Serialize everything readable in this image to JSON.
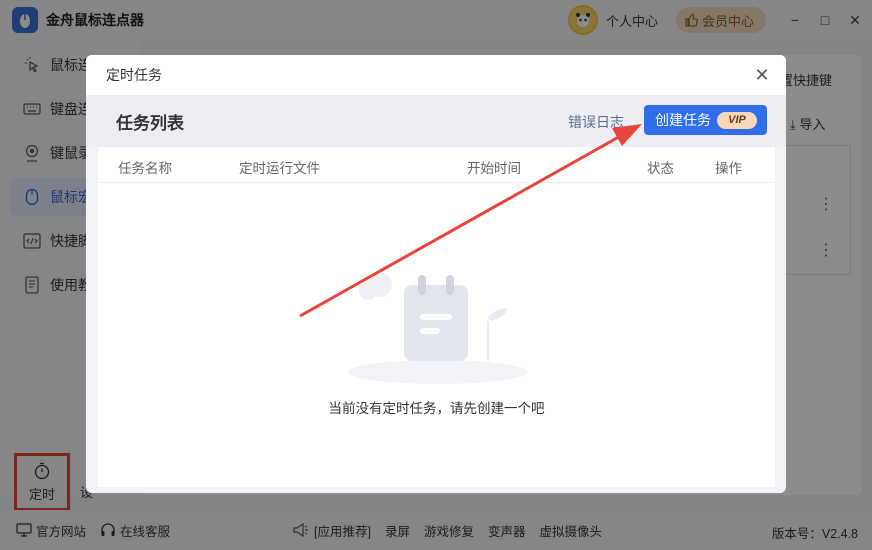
{
  "app": {
    "title": "金舟鼠标连点器",
    "user_center": "个人中心",
    "vip_center": "会员中心",
    "minimize": "−",
    "maximize": "□",
    "close": "✕"
  },
  "sidebar": {
    "items": [
      {
        "label": "鼠标连",
        "icon": "cursor-click-icon"
      },
      {
        "label": "键盘连",
        "icon": "keyboard-icon"
      },
      {
        "label": "键鼠录",
        "icon": "record-icon"
      },
      {
        "label": "鼠标宏",
        "icon": "mouse-icon"
      },
      {
        "label": "快捷脚",
        "icon": "code-icon"
      },
      {
        "label": "使用教",
        "icon": "book-icon"
      }
    ],
    "timer_label": "定时",
    "settings_label": "设"
  },
  "background": {
    "shortcut_text": "置快捷键",
    "import_text": "导入"
  },
  "footer": {
    "website": "官方网站",
    "support": "在线客服",
    "recommend": "[应用推荐]",
    "links": [
      "录屏",
      "游戏修复",
      "变声器",
      "虚拟摄像头"
    ],
    "version": "版本号：V2.4.8"
  },
  "modal": {
    "title": "定时任务",
    "list_title": "任务列表",
    "error_log": "错误日志",
    "create_task": "创建任务",
    "vip_badge": "VIP",
    "columns": [
      "任务名称",
      "定时运行文件",
      "开始时间",
      "状态",
      "操作"
    ],
    "empty_text": "当前没有定时任务，请先创建一个吧"
  },
  "colors": {
    "accent": "#2f6ee6",
    "highlight_red": "#e8443a",
    "vip_gold": "#f0dcc0"
  }
}
